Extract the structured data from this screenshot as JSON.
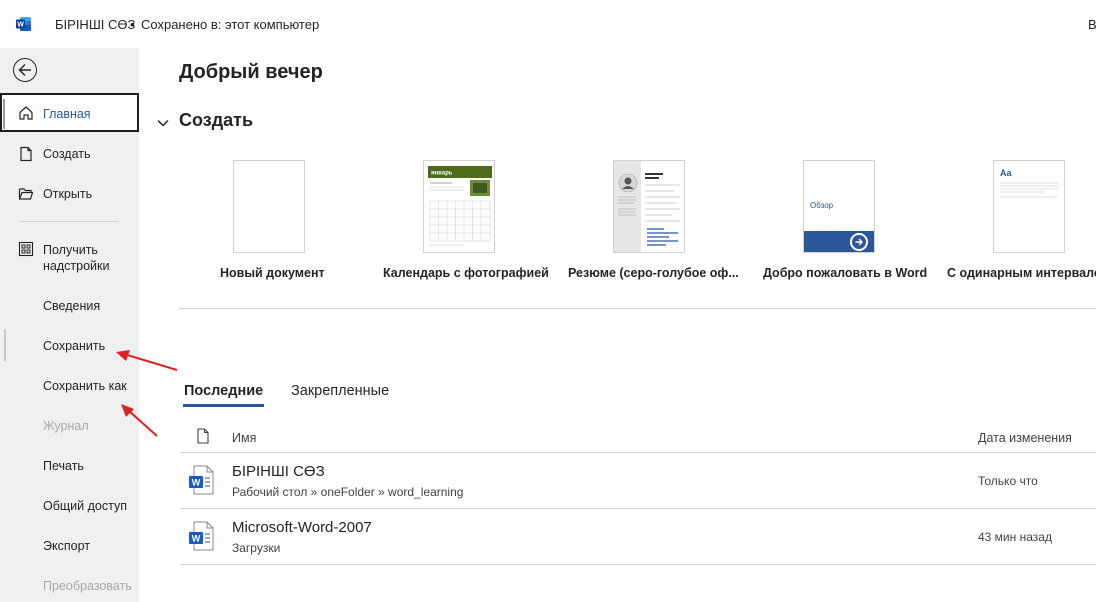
{
  "titlebar": {
    "app_icon": "word-icon",
    "document_name": "БІРІНШІ СӨЗ",
    "separator": "•",
    "save_state": "Сохранено в: этот компьютер",
    "right_clip": "В"
  },
  "sidebar": {
    "back_icon": "back-arrow-icon",
    "items": [
      {
        "label": "Главная",
        "icon": "home-icon",
        "state": "active"
      },
      {
        "label": "Создать",
        "icon": "new-document-icon"
      },
      {
        "label": "Открыть",
        "icon": "open-folder-icon"
      },
      {
        "label": "Получить\nнадстройки",
        "line1": "Получить",
        "line2": "надстройки",
        "icon": "addins-grid-icon"
      },
      {
        "label": "Сведения"
      },
      {
        "label": "Сохранить"
      },
      {
        "label": "Сохранить как"
      },
      {
        "label": "Журнал",
        "state": "disabled"
      },
      {
        "label": "Печать"
      },
      {
        "label": "Общий доступ"
      },
      {
        "label": "Экспорт"
      },
      {
        "label": "Преобразовать",
        "state": "disabled"
      }
    ]
  },
  "main": {
    "greeting": "Добрый вечер",
    "create_section": {
      "title": "Создать",
      "templates": [
        {
          "name": "Новый документ",
          "thumb": "blank"
        },
        {
          "name": "Календарь с фотографией",
          "thumb": "calendar",
          "thumb_text": "январь"
        },
        {
          "name": "Резюме (серо-голубое оф...",
          "thumb": "resume"
        },
        {
          "name": "Добро пожаловать в Word",
          "thumb": "welcome",
          "thumb_text": "Обзор"
        },
        {
          "name": "С одинарным интервалом",
          "thumb": "single-spacing",
          "thumb_text": "Aa"
        }
      ]
    },
    "tabs": [
      {
        "label": "Последние",
        "active": true
      },
      {
        "label": "Закрепленные",
        "active": false
      }
    ],
    "file_list": {
      "columns": {
        "name": "Имя",
        "date": "Дата изменения"
      },
      "rows": [
        {
          "name": "БІРІНШІ СӨЗ",
          "path": "Рабочий стол » oneFolder » word_learning",
          "date": "Только что"
        },
        {
          "name": "Microsoft-Word-2007",
          "path": "Загрузки",
          "date": "43 мин назад"
        }
      ]
    }
  },
  "colors": {
    "word_blue": "#2b579a",
    "sidebar_bg": "#f0f0f0",
    "annotation_red": "#e02020",
    "calendar_green": "#4d6b1a"
  }
}
